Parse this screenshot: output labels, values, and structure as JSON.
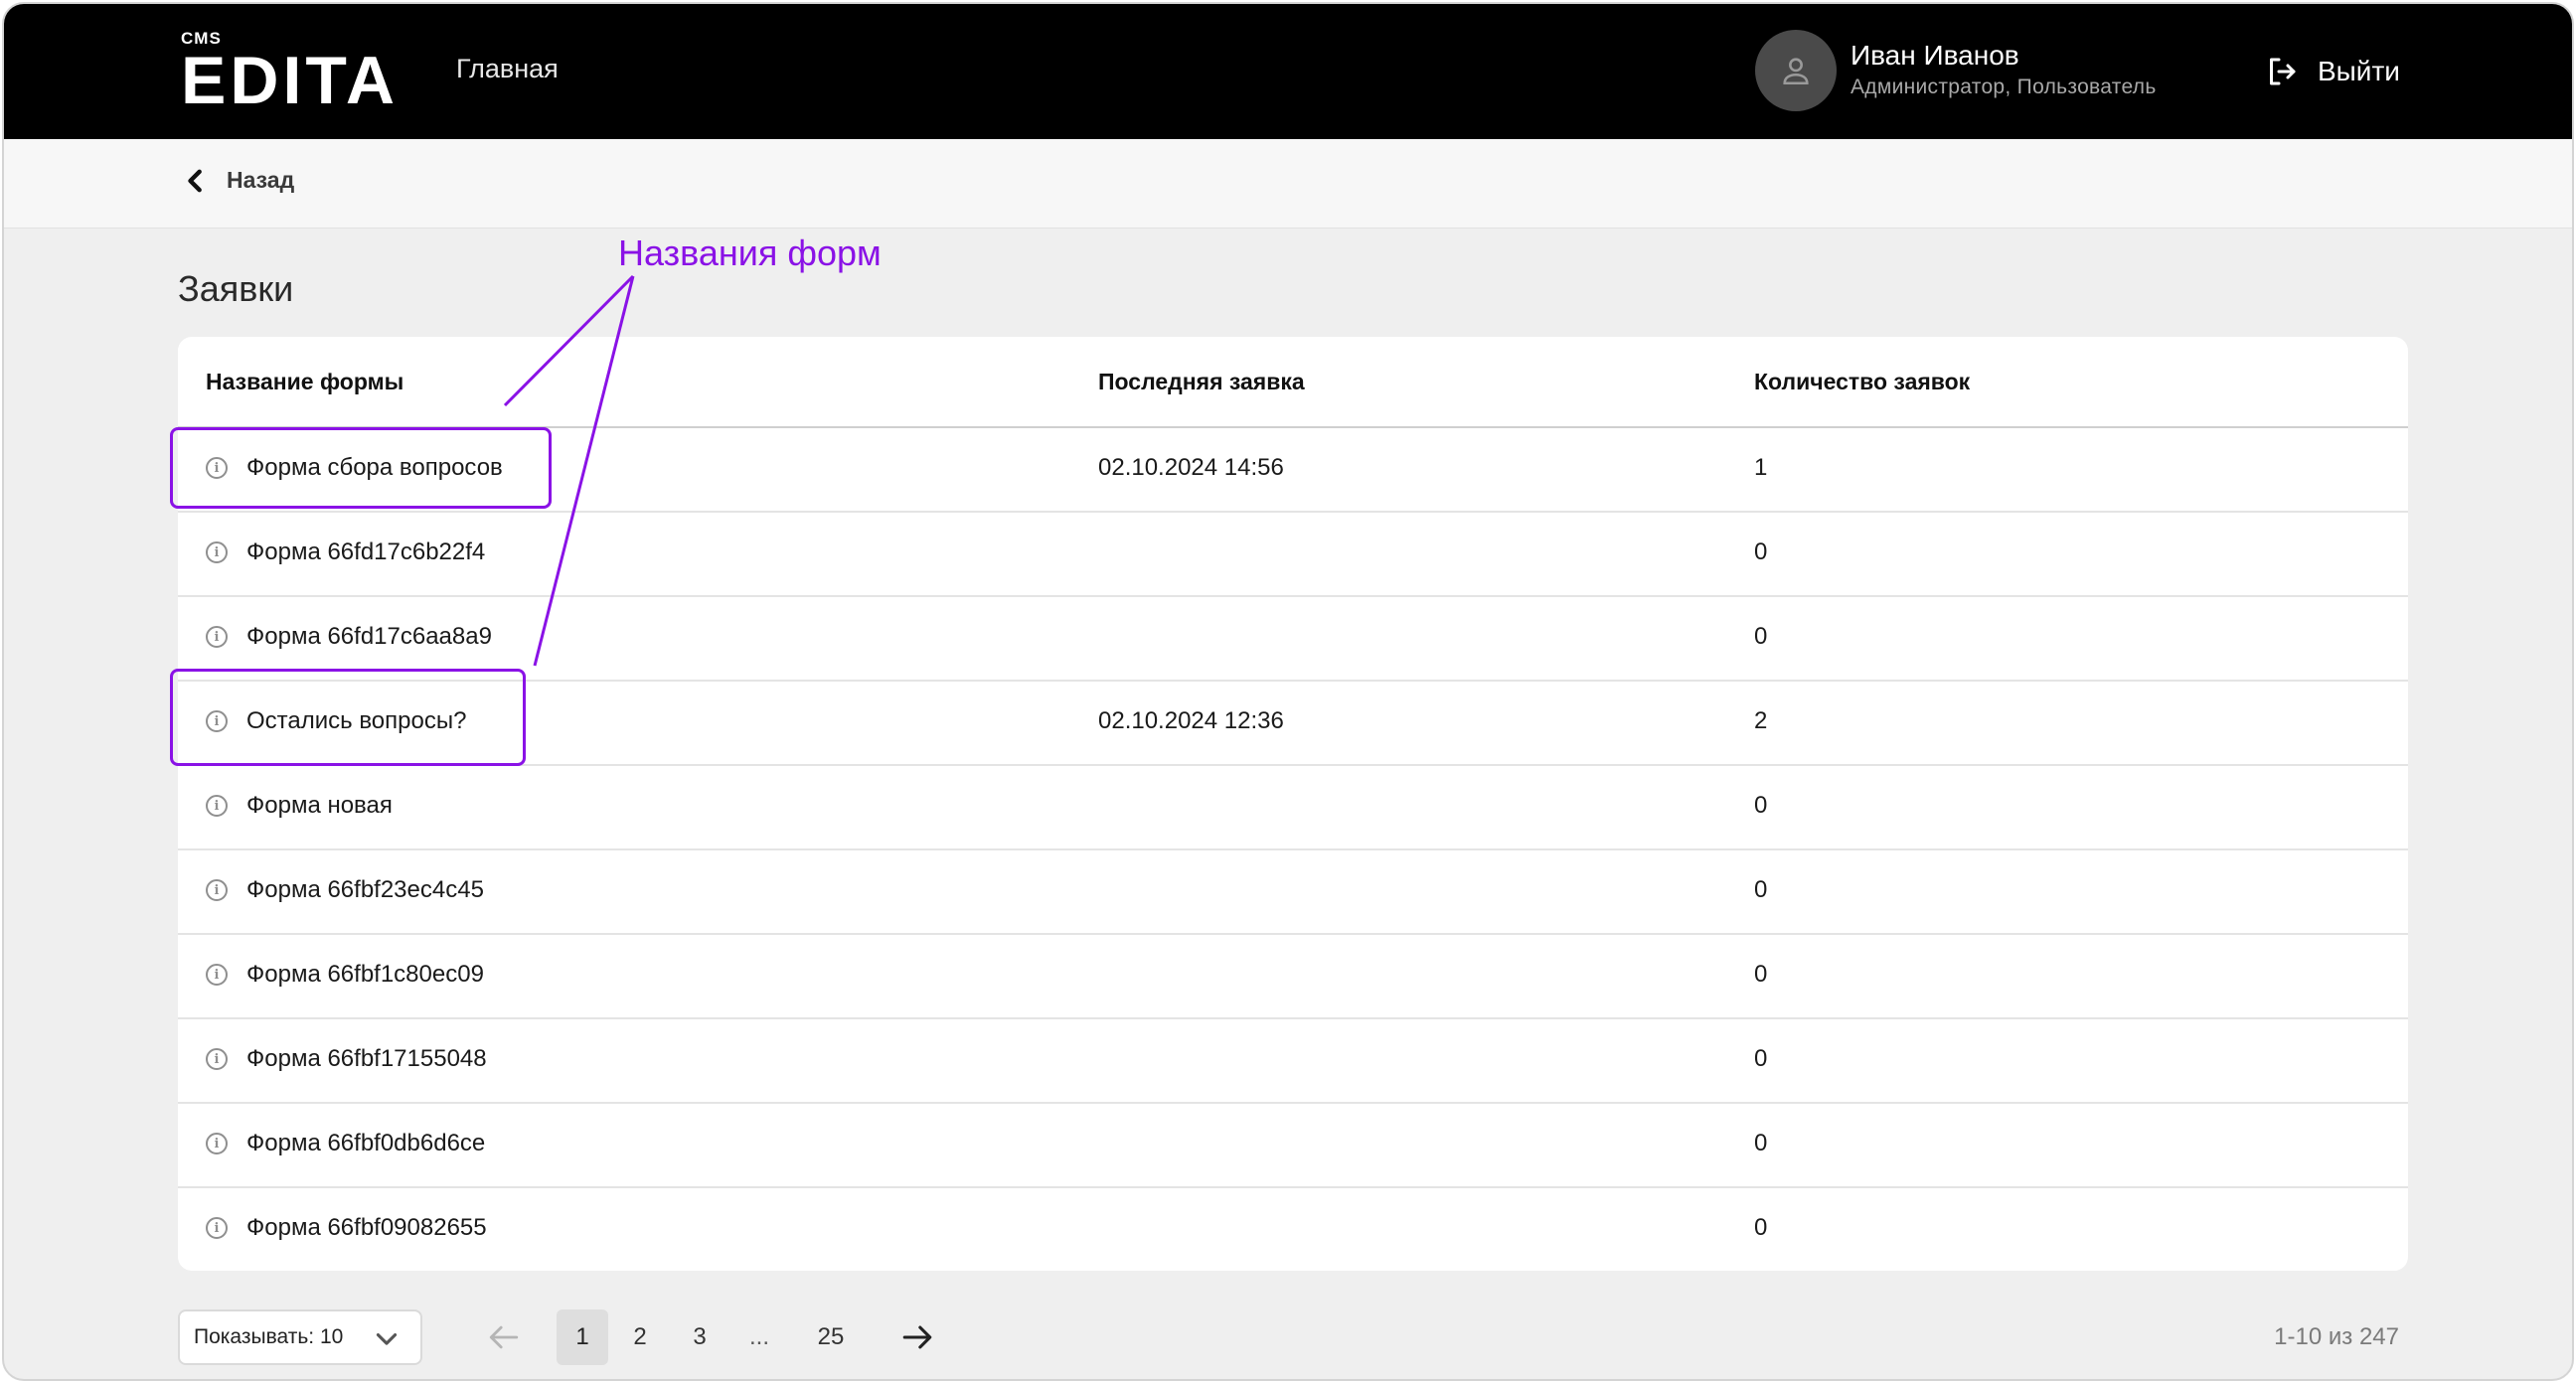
{
  "header": {
    "logo_small": "CMS",
    "logo_big": "EDITA",
    "nav_home": "Главная",
    "user_name": "Иван Иванов",
    "user_role": "Администратор, Пользователь",
    "logout_label": "Выйти"
  },
  "backbar": {
    "back_label": "Назад"
  },
  "page": {
    "title": "Заявки"
  },
  "annotation": {
    "callout": "Названия форм",
    "color": "#8a12e6"
  },
  "table": {
    "columns": [
      "Название формы",
      "Последняя заявка",
      "Количество заявок"
    ],
    "rows": [
      {
        "name": "Форма сбора вопросов",
        "last": "02.10.2024 14:56",
        "count": "1"
      },
      {
        "name": "Форма 66fd17c6b22f4",
        "last": "",
        "count": "0"
      },
      {
        "name": "Форма 66fd17c6aa8a9",
        "last": "",
        "count": "0"
      },
      {
        "name": "Остались вопросы?",
        "last": "02.10.2024 12:36",
        "count": "2"
      },
      {
        "name": "Форма новая",
        "last": "",
        "count": "0"
      },
      {
        "name": "Форма 66fbf23ec4c45",
        "last": "",
        "count": "0"
      },
      {
        "name": "Форма 66fbf1c80ec09",
        "last": "",
        "count": "0"
      },
      {
        "name": "Форма 66fbf17155048",
        "last": "",
        "count": "0"
      },
      {
        "name": "Форма 66fbf0db6d6ce",
        "last": "",
        "count": "0"
      },
      {
        "name": "Форма 66fbf09082655",
        "last": "",
        "count": "0"
      }
    ]
  },
  "pagination": {
    "page_size_label": "Показывать: 10",
    "pages": [
      "1",
      "2",
      "3",
      "25"
    ],
    "ellipsis": "...",
    "current": "1",
    "range": "1-10 из 247"
  },
  "colors": {
    "header_bg": "#000000",
    "page_bg": "#efefef",
    "accent": "#8a12e6"
  },
  "icons": [
    "user-icon",
    "logout-icon",
    "chevron-left-icon",
    "info-icon",
    "chevron-down-icon",
    "arrow-left-icon",
    "arrow-right-icon"
  ]
}
